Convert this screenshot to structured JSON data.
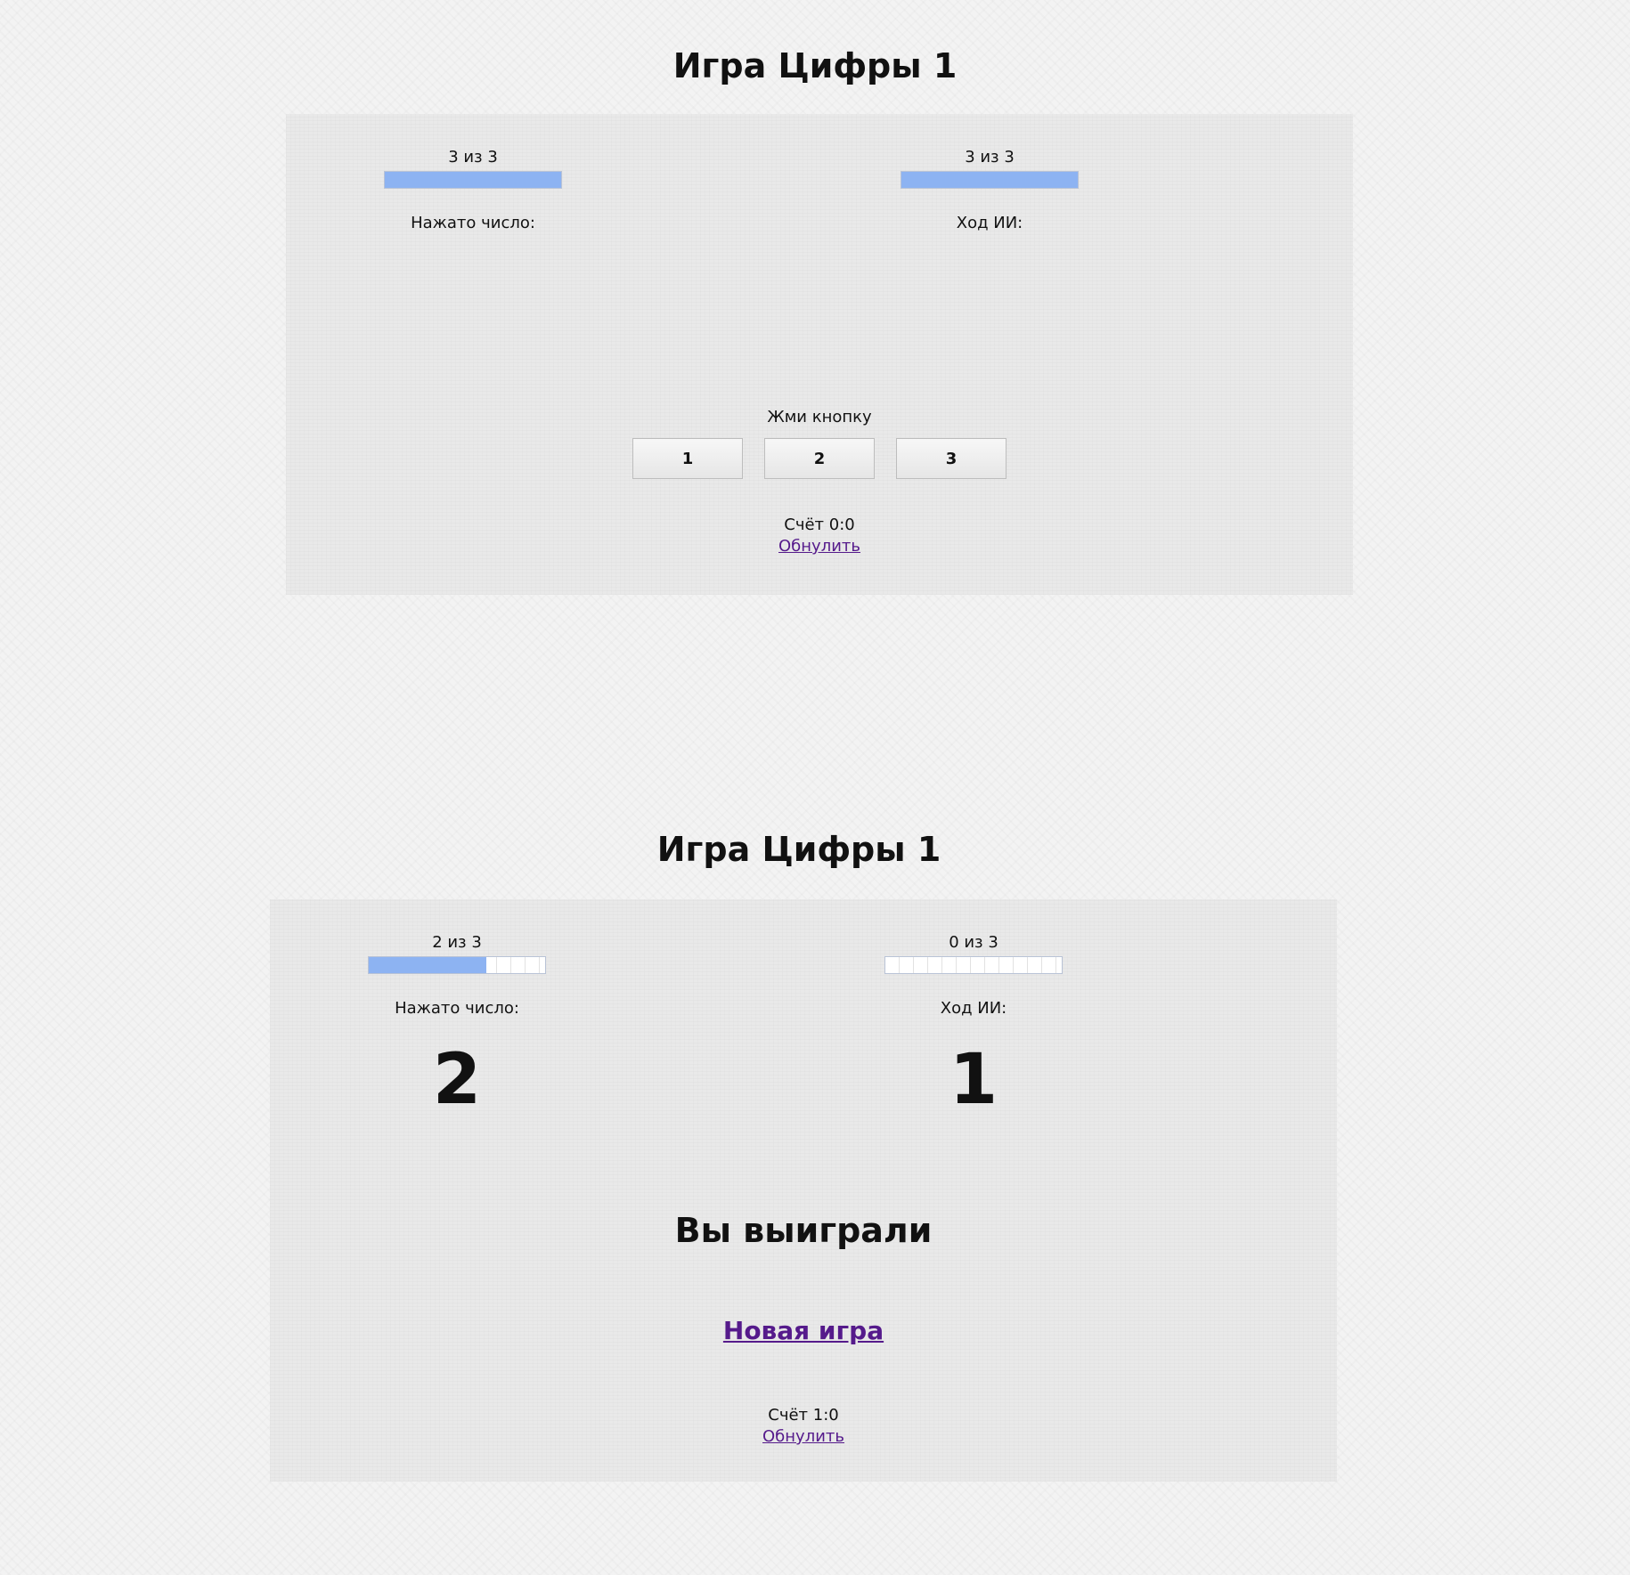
{
  "screen1": {
    "title": "Игра Цифры 1",
    "player": {
      "counter": "3 из 3",
      "progress": 1.0,
      "label": "Нажато число:",
      "value": ""
    },
    "ai": {
      "counter": "3 из 3",
      "progress": 1.0,
      "label": "Ход ИИ:",
      "value": ""
    },
    "prompt": "Жми кнопку",
    "buttons": [
      "1",
      "2",
      "3"
    ],
    "score": "Счёт 0:0",
    "reset_label": "Обнулить"
  },
  "screen2": {
    "title": "Игра Цифры 1",
    "player": {
      "counter": "2 из 3",
      "progress": 0.6667,
      "label": "Нажато число:",
      "value": "2"
    },
    "ai": {
      "counter": "0 из 3",
      "progress": 0.0,
      "label": "Ход ИИ:",
      "value": "1"
    },
    "result": "Вы выиграли",
    "new_game_label": "Новая игра",
    "score": "Счёт 1:0",
    "reset_label": "Обнулить"
  },
  "colors": {
    "bar_fill": "#8db3f2",
    "link": "#551a8b",
    "panel": "#e9e9e9",
    "page": "#f3f3f3"
  }
}
